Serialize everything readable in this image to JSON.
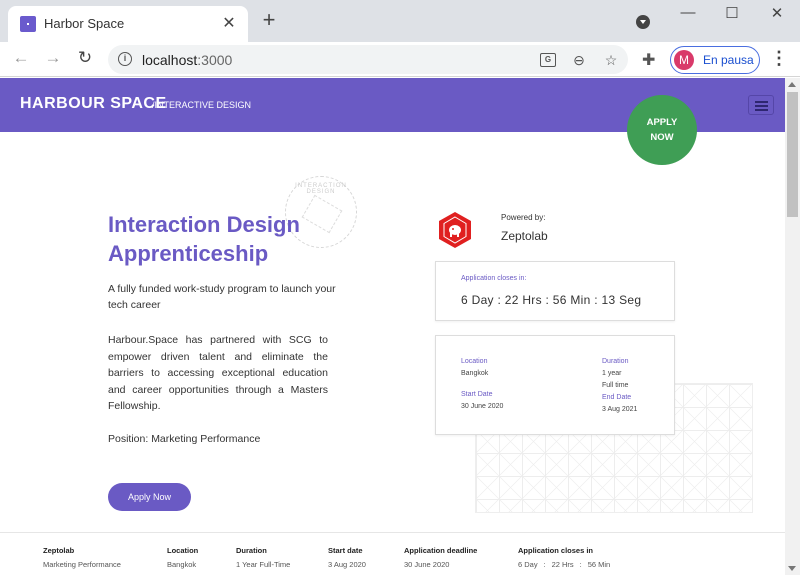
{
  "browser": {
    "tab_title": "Harbor Space",
    "tab_close": "✕",
    "new_tab": "+",
    "url_host": "localhost",
    "url_port": ":3000",
    "profile_initial": "M",
    "profile_status": "En pausa",
    "window_controls": {
      "minimize": "—",
      "maximize": "☐",
      "close": "✕"
    },
    "icons": [
      "back-arrow-icon",
      "forward-arrow-icon",
      "reload-icon",
      "info-icon",
      "translate-icon",
      "zoom-out-icon",
      "star-icon",
      "extensions-icon",
      "more-menu-icon"
    ]
  },
  "header": {
    "brand": "HARBOUR SPACE",
    "section": "/INTERACTIVE DESIGN",
    "apply_badge_line1": "APPLY",
    "apply_badge_line2": "NOW"
  },
  "stamp": {
    "text": "INTERACTION DESIGN"
  },
  "hero": {
    "title": "Interaction Design Apprenticeship",
    "subtitle": "A fully funded work-study program to launch your tech career",
    "body": "Harbour.Space has partnered with SCG to empower driven talent and eliminate the barriers to accessing exceptional education and career opportunities through a Masters Fellowship.",
    "position": "Position: Marketing Performance",
    "apply_button": "Apply Now"
  },
  "partner": {
    "powered_label": "Powered by:",
    "name": "Zeptolab",
    "logo_color": "#e02020"
  },
  "countdown": {
    "label": "Application closes in:",
    "value": "6 Day : 22 Hrs : 56 Min : 13 Seg"
  },
  "details": {
    "location_label": "Location",
    "location": "Bangkok",
    "start_label": "Start Date",
    "start": "30 June 2020",
    "duration_label": "Duration",
    "duration_1": "1 year",
    "duration_2": "Full time",
    "end_label": "End Date",
    "end": "3 Aug 2021"
  },
  "footer": {
    "company": "Zeptolab",
    "company_position": "Marketing Performance",
    "location_label": "Location",
    "location": "Bangkok",
    "duration_label": "Duration",
    "duration": "1 Year Full-Time",
    "start_label": "Start date",
    "start": "3 Aug 2020",
    "deadline_label": "Application deadline",
    "deadline": "30 June 2020",
    "closes_label": "Application closes in",
    "closes_days": "6 Day",
    "closes_hrs": "22 Hrs",
    "closes_min": "56 Min"
  },
  "colors": {
    "brand_purple": "#6a5ac4",
    "apply_green": "#3f9e55",
    "profile_pink": "#d93a6a"
  }
}
